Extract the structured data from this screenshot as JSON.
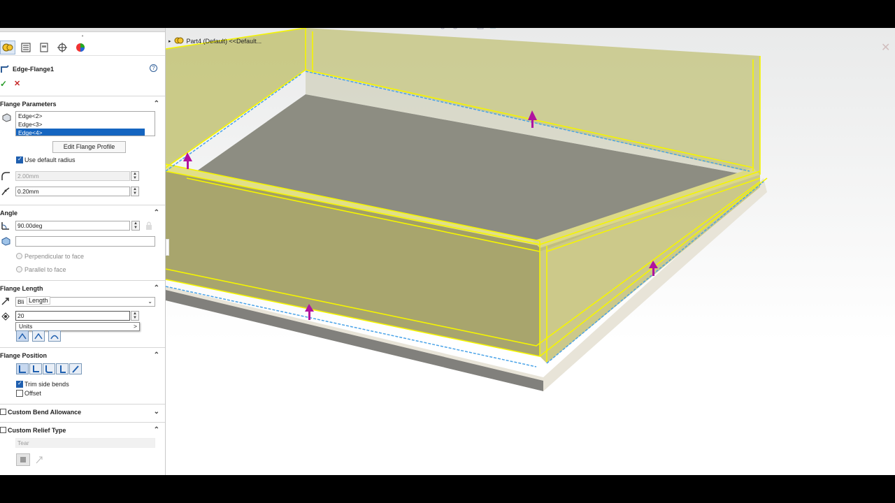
{
  "pm": {
    "feature_title": "Edge-Flange1",
    "help": "?",
    "ok": "✓",
    "cancel": "✕",
    "flange_parameters": {
      "header": "Flange Parameters",
      "edges": [
        "Edge<2>",
        "Edge<3>",
        "Edge<4>"
      ],
      "edit_profile": "Edit Flange Profile",
      "use_default_radius": "Use default radius",
      "radius": "2.00mm",
      "gap": "0.20mm"
    },
    "angle": {
      "header": "Angle",
      "value": "90.00deg",
      "face_ref": "",
      "perpendicular": "Perpendicular to face",
      "parallel": "Parallel to face"
    },
    "flange_length": {
      "header": "Flange Length",
      "end_condition": "Bli",
      "tooltip": "Length",
      "length_value": "20",
      "units_menu": "Units"
    },
    "flange_position": {
      "header": "Flange Position",
      "trim_side_bends": "Trim side bends",
      "offset": "Offset"
    },
    "custom_bend_allowance": "Custom Bend Allowance",
    "custom_relief_type": "Custom Relief Type",
    "relief_type": "Tear"
  },
  "viewport": {
    "tree_label": "Part4 (Default) <<Default..."
  },
  "colors": {
    "flange_yellow": "#f5f500",
    "arrow_magenta": "#b0129f",
    "edge_blue": "#4aa3e8",
    "accent": "#1565c0"
  }
}
